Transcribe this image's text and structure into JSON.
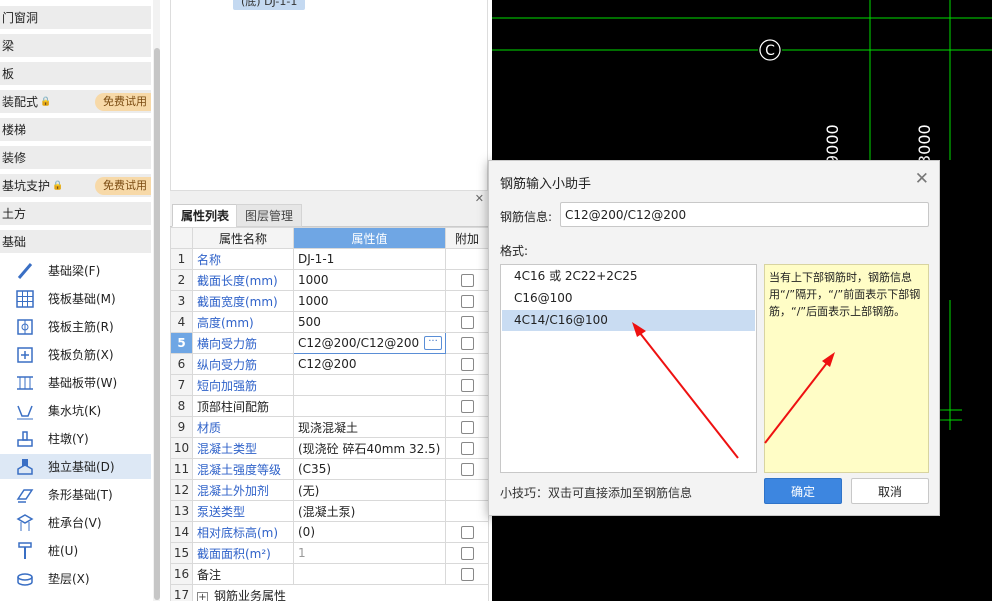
{
  "nav": {
    "categories": [
      {
        "label": "门窗洞",
        "locked": false,
        "trial": ""
      },
      {
        "label": "梁",
        "locked": false,
        "trial": ""
      },
      {
        "label": "板",
        "locked": false,
        "trial": ""
      },
      {
        "label": "装配式",
        "locked": true,
        "trial": "免费试用"
      },
      {
        "label": "楼梯",
        "locked": false,
        "trial": ""
      },
      {
        "label": "装修",
        "locked": false,
        "trial": ""
      },
      {
        "label": "基坑支护",
        "locked": true,
        "trial": "免费试用"
      },
      {
        "label": "土方",
        "locked": false,
        "trial": ""
      },
      {
        "label": "基础",
        "locked": false,
        "trial": ""
      }
    ],
    "items": [
      {
        "label": "基础梁(F)",
        "icon": "beam-icon"
      },
      {
        "label": "筏板基础(M)",
        "icon": "grid-icon"
      },
      {
        "label": "筏板主筋(R)",
        "icon": "main-rebar-icon"
      },
      {
        "label": "筏板负筋(X)",
        "icon": "neg-rebar-icon"
      },
      {
        "label": "基础板带(W)",
        "icon": "strip-icon"
      },
      {
        "label": "集水坑(K)",
        "icon": "sump-icon"
      },
      {
        "label": "柱墩(Y)",
        "icon": "pier-icon"
      },
      {
        "label": "独立基础(D)",
        "icon": "isolated-footing-icon",
        "selected": true
      },
      {
        "label": "条形基础(T)",
        "icon": "strip-footing-icon"
      },
      {
        "label": "桩承台(V)",
        "icon": "pile-cap-icon"
      },
      {
        "label": "桩(U)",
        "icon": "pile-icon"
      },
      {
        "label": "垫层(X)",
        "icon": "cushion-icon"
      }
    ]
  },
  "tree": {
    "chip": "(底) DJ-1-1"
  },
  "props": {
    "tabs": [
      "属性列表",
      "图层管理"
    ],
    "headers": {
      "name": "属性名称",
      "value": "属性值",
      "extra": "附加"
    },
    "rows": [
      {
        "n": "1",
        "name": "名称",
        "value": "DJ-1-1",
        "blue": true,
        "check": false
      },
      {
        "n": "2",
        "name": "截面长度(mm)",
        "value": "1000",
        "blue": true,
        "check": true
      },
      {
        "n": "3",
        "name": "截面宽度(mm)",
        "value": "1000",
        "blue": true,
        "check": true
      },
      {
        "n": "4",
        "name": "高度(mm)",
        "value": "500",
        "blue": true,
        "check": true
      },
      {
        "n": "5",
        "name": "横向受力筋",
        "value": "C12@200/C12@200",
        "blue": true,
        "check": true,
        "current": true
      },
      {
        "n": "6",
        "name": "纵向受力筋",
        "value": "C12@200",
        "blue": true,
        "check": true
      },
      {
        "n": "7",
        "name": "短向加强筋",
        "value": "",
        "blue": true,
        "check": true
      },
      {
        "n": "8",
        "name": "顶部柱间配筋",
        "value": "",
        "blue": false,
        "check": true
      },
      {
        "n": "9",
        "name": "材质",
        "value": "现浇混凝土",
        "blue": true,
        "check": true
      },
      {
        "n": "10",
        "name": "混凝土类型",
        "value": "(现浇砼 碎石40mm 32.5)",
        "blue": true,
        "check": true
      },
      {
        "n": "11",
        "name": "混凝土强度等级",
        "value": "(C35)",
        "blue": true,
        "check": true
      },
      {
        "n": "12",
        "name": "混凝土外加剂",
        "value": "(无)",
        "blue": true,
        "check": false
      },
      {
        "n": "13",
        "name": "泵送类型",
        "value": "(混凝土泵)",
        "blue": true,
        "check": false
      },
      {
        "n": "14",
        "name": "相对底标高(m)",
        "value": "(0)",
        "blue": true,
        "check": true
      },
      {
        "n": "15",
        "name": "截面面积(m²)",
        "value": "1",
        "blue": true,
        "check": true,
        "grey": true
      },
      {
        "n": "16",
        "name": "备注",
        "value": "",
        "blue": false,
        "check": true
      },
      {
        "n": "17",
        "name": "钢筋业务属性",
        "value": "",
        "blue": false,
        "check": false,
        "expand": true
      }
    ]
  },
  "cad": {
    "axis_label": "C",
    "dim_labels": [
      "9000",
      "3000"
    ],
    "line_color": "#00ff00"
  },
  "dialog": {
    "title": "钢筋输入小助手",
    "info_label": "钢筋信息:",
    "info_value": "C12@200/C12@200",
    "format_label": "格式:",
    "formats": [
      "4C16 或 2C22+2C25",
      "C16@100",
      "4C14/C16@100"
    ],
    "selected_format": 2,
    "tip": "当有上下部钢筋时，钢筋信息用“/”隔开，“/”前面表示下部钢筋，“/”后面表示上部钢筋。",
    "hint": "小技巧：双击可直接添加至钢筋信息",
    "ok": "确定",
    "cancel": "取消"
  },
  "annotation_color": "#ee1111"
}
